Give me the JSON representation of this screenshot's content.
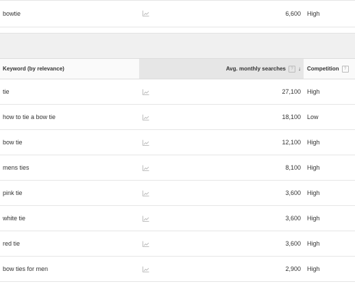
{
  "top_row": {
    "keyword": "bowtie",
    "avg": "6,600",
    "competition": "High"
  },
  "header": {
    "keyword": "Keyword (by relevance)",
    "avg": "Avg. monthly searches",
    "competition": "Competition",
    "help_glyph": "?",
    "sort_glyph": "↓"
  },
  "rows": [
    {
      "keyword": "tie",
      "avg": "27,100",
      "competition": "High"
    },
    {
      "keyword": "how to tie a bow tie",
      "avg": "18,100",
      "competition": "Low"
    },
    {
      "keyword": "bow tie",
      "avg": "12,100",
      "competition": "High"
    },
    {
      "keyword": "mens ties",
      "avg": "8,100",
      "competition": "High"
    },
    {
      "keyword": "pink tie",
      "avg": "3,600",
      "competition": "High"
    },
    {
      "keyword": "white tie",
      "avg": "3,600",
      "competition": "High"
    },
    {
      "keyword": "red tie",
      "avg": "3,600",
      "competition": "High"
    },
    {
      "keyword": "bow ties for men",
      "avg": "2,900",
      "competition": "High"
    }
  ],
  "icons": {
    "trend": "trend-chart-icon",
    "help": "help-icon",
    "sort": "sort-desc-icon"
  }
}
